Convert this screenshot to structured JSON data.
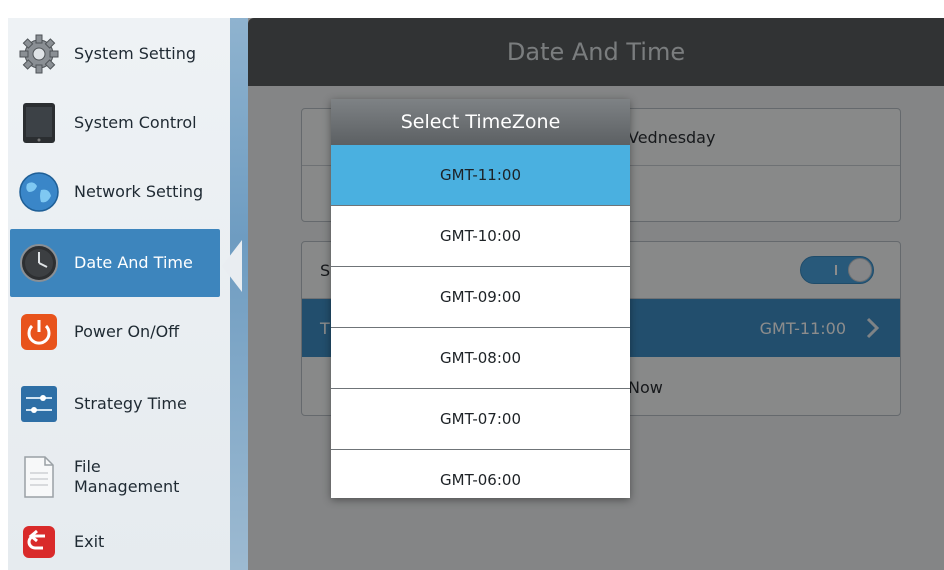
{
  "sidebar": {
    "items": [
      {
        "label": "System Setting",
        "icon": "gear-icon",
        "active": false
      },
      {
        "label": "System Control",
        "icon": "tablet-icon",
        "active": false
      },
      {
        "label": "Network Setting",
        "icon": "globe-icon",
        "active": false
      },
      {
        "label": "Date And Time",
        "icon": "clock-icon",
        "active": true
      },
      {
        "label": "Power On/Off",
        "icon": "power-icon",
        "active": false
      },
      {
        "label": "Strategy Time",
        "icon": "sliders-icon",
        "active": false
      },
      {
        "label": "File\nManagement",
        "icon": "file-icon",
        "active": false
      },
      {
        "label": "Exit",
        "icon": "exit-icon",
        "active": false
      }
    ]
  },
  "main": {
    "title": "Date And Time",
    "panel1": {
      "row1_partial": "Vednesday"
    },
    "panel2": {
      "row1_partial": "S",
      "row2_partial": "T",
      "timezone_value": "GMT-11:00",
      "row3_partial": "Now"
    }
  },
  "dialog": {
    "title": "Select TimeZone",
    "options": [
      "GMT-11:00",
      "GMT-10:00",
      "GMT-09:00",
      "GMT-08:00",
      "GMT-07:00",
      "GMT-06:00"
    ],
    "selected": "GMT-11:00"
  },
  "colors": {
    "accent": "#3f8fc6",
    "selected_option": "#4ab0e0",
    "header_bg": "#5a5d60"
  }
}
